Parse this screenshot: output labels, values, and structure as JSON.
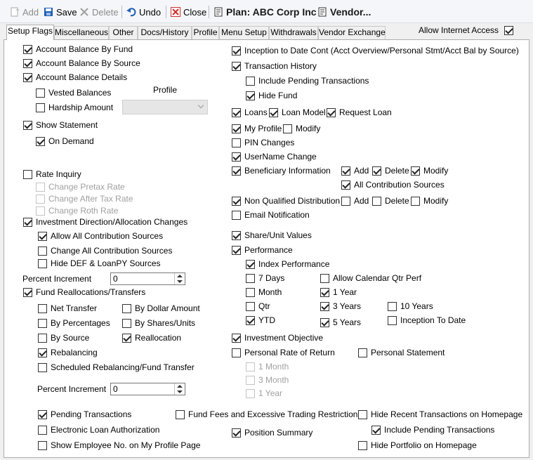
{
  "toolbar": {
    "add": "Add",
    "save": "Save",
    "delete": "Delete",
    "undo": "Undo",
    "close": "Close",
    "plan": "Plan: ABC Corp Inc",
    "vendor": "Vendor..."
  },
  "tabs": [
    "Setup Flags",
    "Miscellaneous",
    "Other",
    "Docs/History",
    "Profile",
    "Menu Setup",
    "Withdrawals",
    "Vendor Exchange"
  ],
  "allow_internet_access": "Allow Internet Access",
  "labels": {
    "profile": "Profile",
    "percent_increment_1": "Percent Increment",
    "percent_increment_2": "Percent Increment"
  },
  "inputs": {
    "percent_increment_1": "0",
    "percent_increment_2": "0"
  },
  "checkboxes": {
    "account_balance_by_fund": "Account Balance By Fund",
    "account_balance_by_source": "Account Balance By Source",
    "account_balance_details": "Account Balance Details",
    "vested_balances": "Vested Balances",
    "hardship_amount": "Hardship Amount",
    "show_statement": "Show Statement",
    "on_demand": "On Demand",
    "rate_inquiry": "Rate Inquiry",
    "change_pretax_rate": "Change Pretax Rate",
    "change_after_tax_rate": "Change After Tax Rate",
    "change_roth_rate": "Change Roth Rate",
    "investment_direction": "Investment Direction/Allocation Changes",
    "allow_all_contribution_sources": "Allow All Contribution Sources",
    "change_all_contribution_sources": "Change All Contribution Sources",
    "hide_def_loanpy": "Hide DEF & LoanPY Sources",
    "fund_reallocations": "Fund Reallocations/Transfers",
    "net_transfer": "Net Transfer",
    "by_dollar_amount": "By Dollar Amount",
    "by_percentages": "By Percentages",
    "by_shares_units": "By Shares/Units",
    "by_source": "By Source",
    "reallocation": "Reallocation",
    "rebalancing": "Rebalancing",
    "scheduled_rebalancing": "Scheduled Rebalancing/Fund Transfer",
    "pending_transactions": "Pending Transactions",
    "electronic_loan_authorization": "Electronic Loan Authorization",
    "show_employee_no": "Show Employee No. on My Profile Page",
    "fund_fees": "Fund Fees and Excessive Trading Restrictions",
    "position_summary": "Position Summary",
    "hide_recent_transactions": "Hide Recent Transactions on Homepage",
    "include_pending_transactions_home": "Include Pending Transactions",
    "hide_portfolio": "Hide Portfolio on Homepage",
    "inception_to_date_cont": "Inception to Date Cont (Acct Overview/Personal Stmt/Acct Bal by Source)",
    "transaction_history": "Transaction History",
    "include_pending_transactions": "Include Pending Transactions",
    "hide_fund": "Hide Fund",
    "loans": "Loans",
    "loan_model": "Loan Model",
    "request_loan": "Request Loan",
    "my_profile": "My Profile",
    "modify_profile": "Modify",
    "pin_changes": "PIN Changes",
    "username_change": "UserName Change",
    "beneficiary_information": "Beneficiary Information",
    "ben_add": "Add",
    "ben_delete": "Delete",
    "ben_modify": "Modify",
    "ben_all_contribution_sources": "All Contribution Sources",
    "non_qualified_distribution": "Non Qualified Distribution",
    "nqd_add": "Add",
    "nqd_delete": "Delete",
    "nqd_modify": "Modify",
    "email_notification": "Email Notification",
    "share_unit_values": "Share/Unit Values",
    "performance": "Performance",
    "index_performance": "Index Performance",
    "perf_7_days": "7 Days",
    "allow_calendar_qtr_perf": "Allow Calendar Qtr Perf",
    "perf_month": "Month",
    "perf_1_year": "1 Year",
    "perf_qtr": "Qtr",
    "perf_3_years": "3 Years",
    "perf_10_years": "10 Years",
    "perf_ytd": "YTD",
    "perf_5_years": "5 Years",
    "perf_inception_to_date": "Inception To Date",
    "investment_objective": "Investment Objective",
    "personal_rate_of_return": "Personal Rate of Return",
    "personal_statement": "Personal Statement",
    "prr_1_month": "1 Month",
    "prr_3_month": "3 Month",
    "prr_1_year": "1 Year"
  },
  "colors": {
    "accent_blue": "#1f5fb4",
    "close_red": "#d0312d"
  },
  "icons": {
    "add": "add-icon",
    "save": "save-icon",
    "delete": "delete-icon",
    "undo": "undo-icon",
    "close": "close-icon",
    "plan": "plan-icon",
    "vendor": "vendor-icon"
  }
}
